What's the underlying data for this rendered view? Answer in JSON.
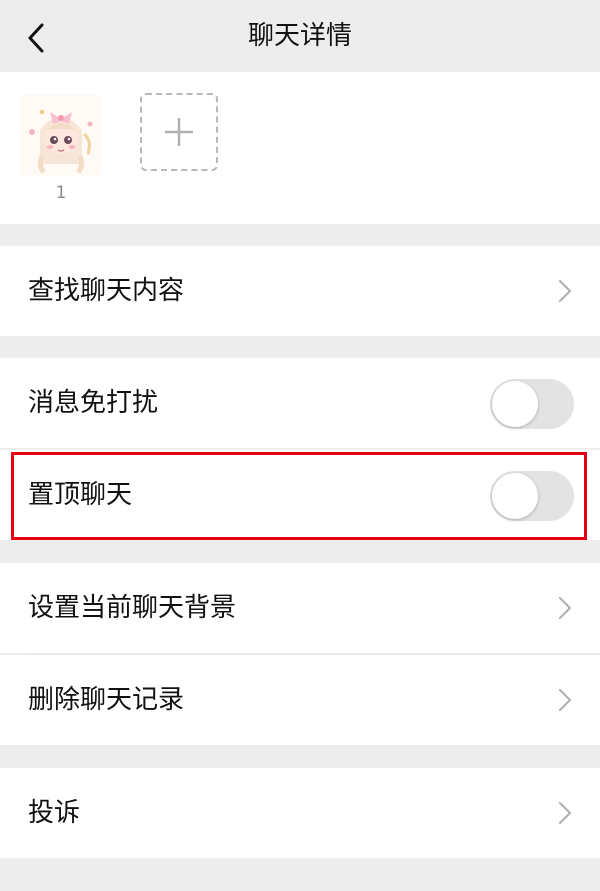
{
  "header": {
    "title": "聊天详情",
    "back_icon": "chevron-left-icon"
  },
  "members": {
    "items": [
      {
        "name": "1",
        "avatar": "avatar-anime-girl"
      }
    ],
    "add_icon": "plus-icon"
  },
  "rows": {
    "search_history": {
      "label": "查找聊天内容",
      "icon": "chevron-right-icon"
    },
    "mute": {
      "label": "消息免打扰",
      "enabled": false
    },
    "pin_chat": {
      "label": "置顶聊天",
      "enabled": false
    },
    "set_background": {
      "label": "设置当前聊天背景",
      "icon": "chevron-right-icon"
    },
    "clear_history": {
      "label": "删除聊天记录",
      "icon": "chevron-right-icon"
    },
    "report": {
      "label": "投诉",
      "icon": "chevron-right-icon"
    }
  },
  "colors": {
    "background": "#ededed",
    "card": "#ffffff",
    "toggle_off": "#e3e3e3",
    "highlight": "#e60012",
    "secondary_text": "#8a8a8a"
  }
}
